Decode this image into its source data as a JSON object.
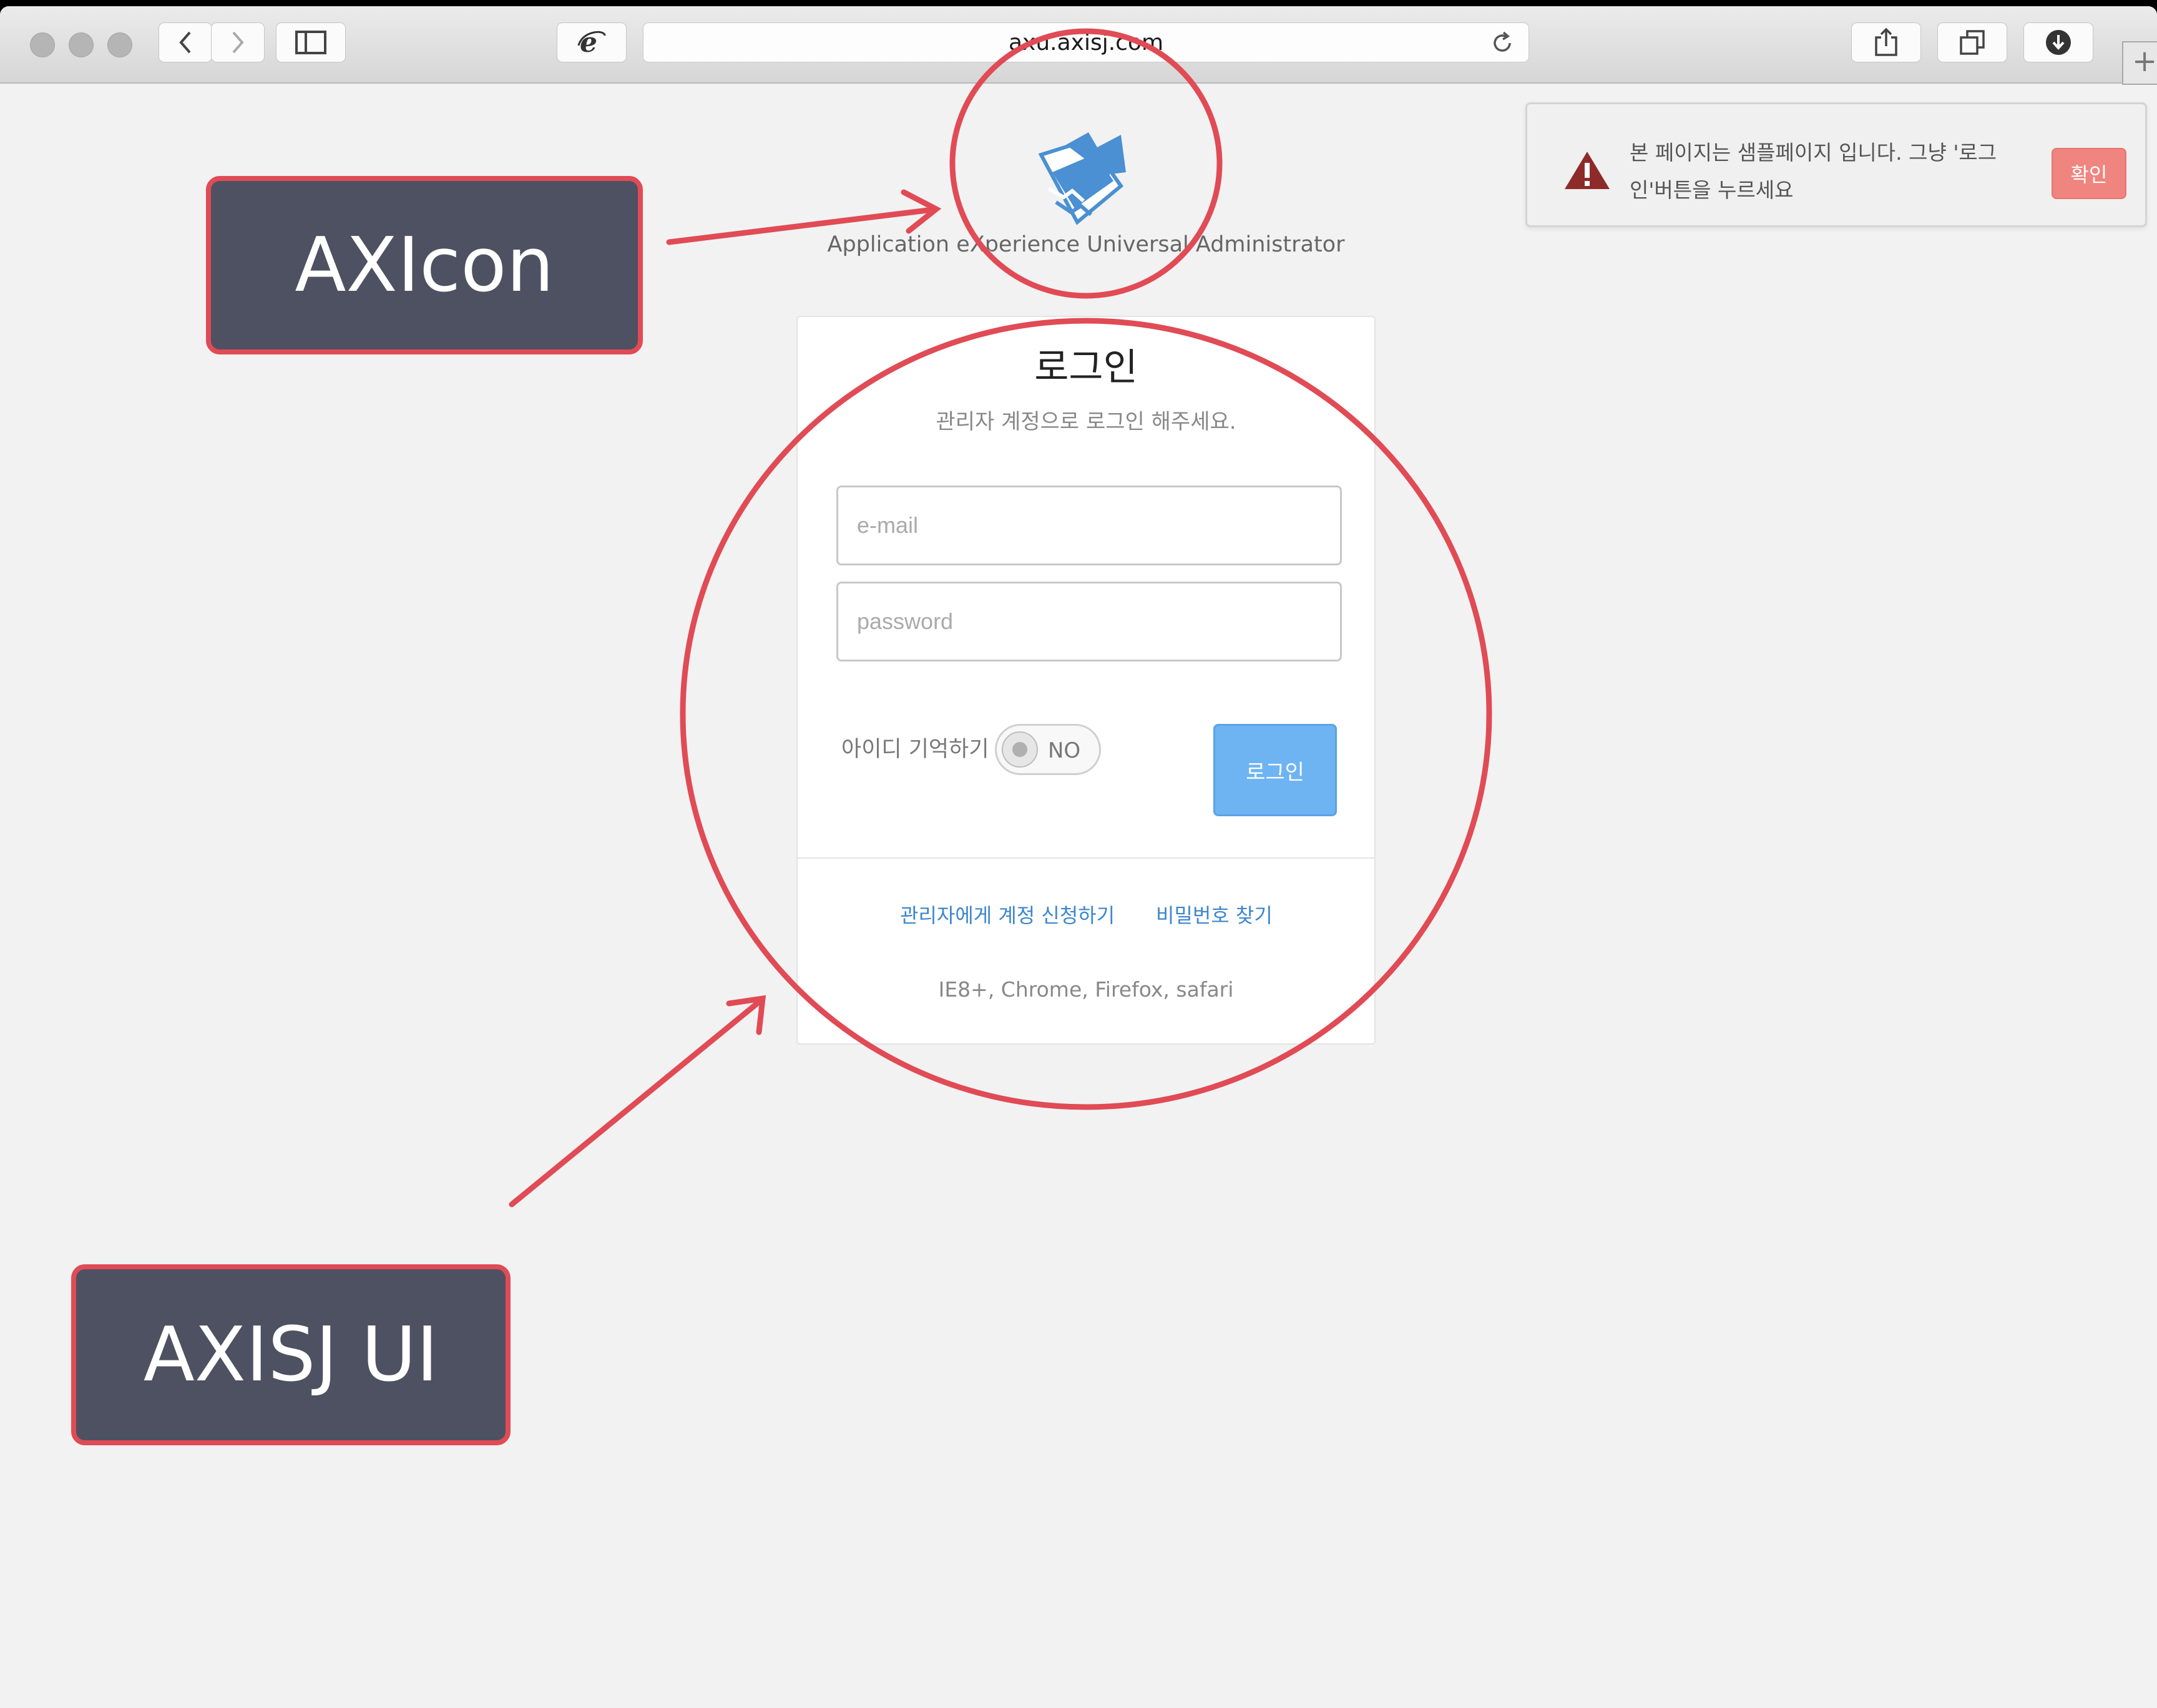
{
  "browser": {
    "url": "axu.axisj.com",
    "buttons": {
      "back": "back-icon",
      "forward": "forward-icon",
      "sidebar": "sidebar-icon",
      "site": "ie-icon",
      "share": "share-icon",
      "tabs": "tabs-icon",
      "downloads": "download-icon",
      "reload": "reload-icon",
      "new_tab": "+"
    }
  },
  "brand": {
    "title": "Application eXperience Universal Administrator",
    "logo_color": "#4a90d2"
  },
  "login": {
    "title": "로그인",
    "subtitle": "관리자 계정으로 로그인 해주세요.",
    "email_placeholder": "e-mail",
    "password_placeholder": "password",
    "remember_label": "아이디 기억하기",
    "toggle_value": "NO",
    "submit_label": "로그인",
    "links": {
      "request_account": "관리자에게 계정 신청하기",
      "find_password": "비밀번호 찾기"
    },
    "browsers": "IE8+, Chrome, Firefox, safari",
    "accent_color": "#6eb4f3"
  },
  "toast": {
    "message": "본 페이지는 샘플페이지 입니다. 그냥 '로그인'버튼을 누르세요",
    "confirm_label": "확인",
    "icon": "warning-icon"
  },
  "annotations": {
    "axicon_label": "AXIcon",
    "axisj_label": "AXISJ UI",
    "color": "#e04b55"
  }
}
